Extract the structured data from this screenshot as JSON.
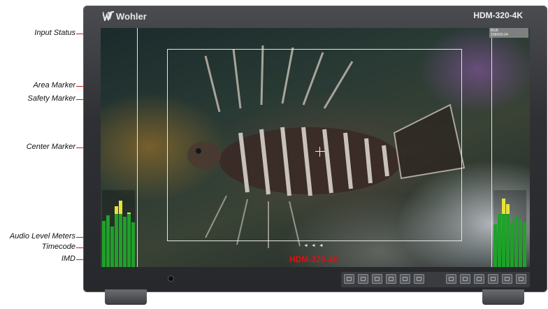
{
  "monitor": {
    "brand": "Wohler",
    "model": "HDM-320-4K"
  },
  "screen": {
    "input_status_lines": [
      "RGB",
      "1080i59.94"
    ],
    "timecode": "◄ ◄ ◄",
    "imd_text": "HDM-320-4K"
  },
  "callouts": [
    {
      "id": "input-status",
      "label": "Input Status"
    },
    {
      "id": "area-marker",
      "label": "Area Marker"
    },
    {
      "id": "safety-marker",
      "label": "Safety Marker"
    },
    {
      "id": "center-marker",
      "label": "Center Marker"
    },
    {
      "id": "audio-level-meters",
      "label": "Audio Level Meters"
    },
    {
      "id": "timecode",
      "label": "Timecode"
    },
    {
      "id": "imd",
      "label": "IMD"
    }
  ],
  "audio_meters": {
    "left_levels": [
      0.62,
      0.7,
      0.55,
      0.82,
      0.9,
      0.68,
      0.74,
      0.6
    ],
    "right_levels": [
      0.58,
      0.72,
      0.92,
      0.85,
      0.6,
      0.7,
      0.64,
      0.6
    ]
  },
  "colors": {
    "callout_line": "#c51a1a",
    "imd": "#e01010",
    "meter_green": "#1fa12a",
    "meter_yellow": "#e8e23a"
  },
  "controls": {
    "button_count_left": 6,
    "button_count_right": 6
  }
}
